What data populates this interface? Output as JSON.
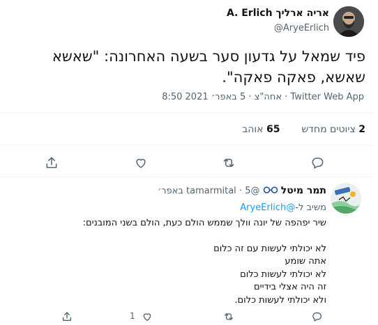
{
  "tweet": {
    "author_name": "אריה ארליך A. Erlich",
    "author_handle": "@AryeErlich",
    "text": "פיד שמאל על גדעון סער בשעה האחרונה: \"שאשא שאשא, פאקה פאקה\".",
    "meta": "8:50 אחה\"צ · 5 באפר׳ 2021 · Twitter Web App",
    "retweets_count": "2",
    "retweets_label": "ציוטים מחדש",
    "likes_count": "65",
    "likes_label": "אוהב"
  },
  "reply": {
    "author_name": "תמר מיטל",
    "author_handle": "@tamarmital",
    "date": "5 באפר׳",
    "replying_to_prefix": "משיב ל-",
    "replying_to_handle": "@AryeErlich",
    "lines": [
      "שיר יפהפה של יונה וולך שממש הולם כעת, הולם בשני המובנים:",
      "",
      "לא יכולתי לעשות עם זה כלום",
      "אתה שומע",
      "לא יכולתי לעשות כלום",
      "זה היה אצלי בידיים",
      "ולא יכולתי לעשות כלום."
    ],
    "like_count": "1"
  },
  "colors": {
    "text": "#0f1419",
    "muted": "#536471",
    "link": "#1d9bf0",
    "border": "#eff3f4"
  },
  "icons": {
    "share": "share-icon",
    "like": "heart-icon",
    "retweet": "retweet-icon",
    "reply": "reply-icon",
    "glasses": "glasses-emoji"
  }
}
